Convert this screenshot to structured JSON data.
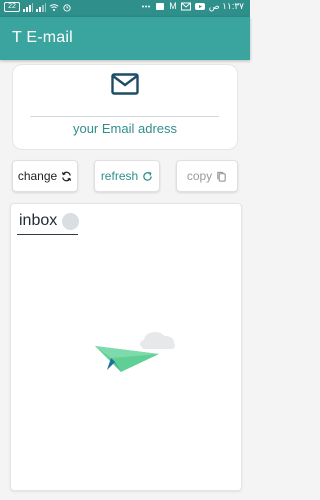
{
  "status_bar": {
    "battery": "22",
    "time": "١١:٣٧ ص",
    "indicator": "M",
    "icons": [
      "battery-icon",
      "signal-icon",
      "signal-icon",
      "wifi-icon",
      "alarm-icon",
      "youtube-icon",
      "gmail-icon",
      "notification-icon",
      "dots-icon"
    ]
  },
  "app": {
    "title": "T E-mail",
    "accent": "#3aa59f",
    "accent_dark": "#2f8f8a"
  },
  "email_card": {
    "icon": "envelope-icon",
    "address": "your Email adress"
  },
  "actions": {
    "change_label": "change",
    "change_icon": "sync-icon",
    "refresh_label": "refresh",
    "refresh_icon": "refresh-icon",
    "copy_label": "copy",
    "copy_icon": "copy-icon"
  },
  "inbox": {
    "title": "inbox",
    "empty_illustration": "paper-plane-icon"
  }
}
